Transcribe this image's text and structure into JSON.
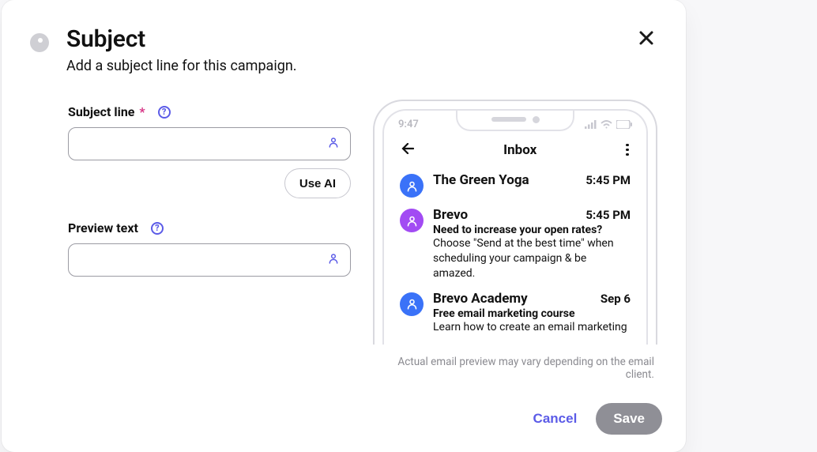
{
  "header": {
    "title": "Subject",
    "subtitle": "Add a subject line for this campaign."
  },
  "form": {
    "subject_label": "Subject line",
    "subject_value": "",
    "preview_label": "Preview text",
    "preview_value": "",
    "use_ai_label": "Use AI",
    "required_mark": "*",
    "help_glyph": "?"
  },
  "phone": {
    "time": "9:47",
    "inbox_title": "Inbox",
    "emails": [
      {
        "sender": "The Green Yoga",
        "time": "5:45 PM",
        "subject": "",
        "preview": ""
      },
      {
        "sender": "Brevo",
        "time": "5:45 PM",
        "subject": "Need to increase your open rates?",
        "preview": "Choose \"Send at the best time\" when scheduling your campaign & be amazed."
      },
      {
        "sender": "Brevo Academy",
        "time": "Sep 6",
        "subject": "Free email marketing course",
        "preview": "Learn how to create an email marketing"
      }
    ],
    "disclaimer": "Actual email preview may vary depending on the email client."
  },
  "footer": {
    "cancel_label": "Cancel",
    "save_label": "Save"
  }
}
